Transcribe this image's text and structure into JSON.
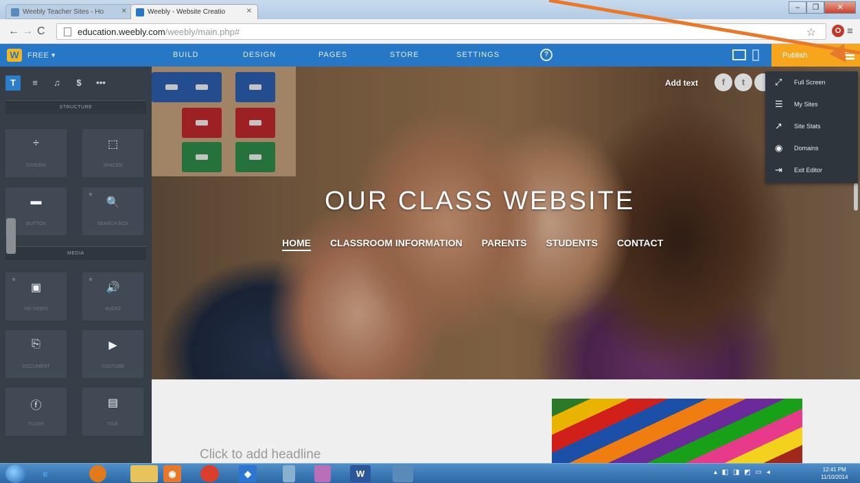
{
  "browser": {
    "tabs": [
      {
        "label": "Weebly Teacher Sites - Ho"
      },
      {
        "label": "Weebly - Website Creatio"
      }
    ],
    "url_host": "education.weebly.com",
    "url_path": "/weebly/main.php#"
  },
  "weebly_bar": {
    "logo": "W",
    "plan": "FREE ▾",
    "tabs": [
      "BUILD",
      "DESIGN",
      "PAGES",
      "STORE",
      "SETTINGS"
    ],
    "help": "?",
    "publish": "Publish"
  },
  "sidebar": {
    "tool_tabs": [
      "T",
      "≡",
      "♫",
      "$",
      "•••"
    ],
    "sections": [
      "STRUCTURE",
      "MEDIA"
    ],
    "elements": [
      {
        "label": "DIVIDER",
        "icon": "divider-icon",
        "glyph": "÷"
      },
      {
        "label": "SPACER",
        "icon": "spacer-icon",
        "glyph": "⬚"
      },
      {
        "label": "BUTTON",
        "icon": "button-icon",
        "glyph": "▬"
      },
      {
        "label": "SEARCH BOX",
        "icon": "search-box-icon",
        "glyph": "🔍"
      },
      {
        "label": "HD VIDEO",
        "icon": "video-icon",
        "glyph": "▣"
      },
      {
        "label": "AUDIO",
        "icon": "audio-icon",
        "glyph": "🔊"
      },
      {
        "label": "DOCUMENT",
        "icon": "document-icon",
        "glyph": "⎘"
      },
      {
        "label": "YOUTUBE",
        "icon": "youtube-icon",
        "glyph": "▶"
      },
      {
        "label": "FLASH",
        "icon": "flash-icon",
        "glyph": "ⓕ"
      },
      {
        "label": "FILE",
        "icon": "file-icon",
        "glyph": "▤"
      }
    ]
  },
  "site": {
    "title": "OUR CLASS WEBSITE",
    "nav": [
      "HOME",
      "CLASSROOM INFORMATION",
      "PARENTS",
      "STUDENTS",
      "CONTACT"
    ],
    "add_text": "Add text",
    "headline_placeholder": "Click to add headline"
  },
  "menu": {
    "items": [
      {
        "label": "Full Screen",
        "icon": "full-screen-icon",
        "glyph": "⤢"
      },
      {
        "label": "My Sites",
        "icon": "list-icon",
        "glyph": "☰"
      },
      {
        "label": "Site Stats",
        "icon": "stats-icon",
        "glyph": "↗"
      },
      {
        "label": "Domains",
        "icon": "globe-icon",
        "glyph": "◉"
      },
      {
        "label": "Exit Editor",
        "icon": "exit-icon",
        "glyph": "⇥"
      }
    ]
  },
  "taskbar": {
    "clock_time": "12:41 PM",
    "clock_date": "11/10/2014"
  },
  "colors": {
    "weebly_blue": "#2677c5",
    "publish_orange": "#f7a51c",
    "annotation_arrow": "#e8782a"
  }
}
